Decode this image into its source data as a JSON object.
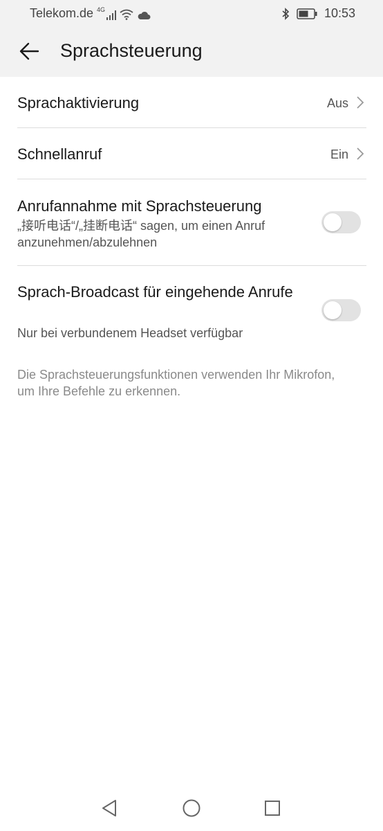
{
  "status_bar": {
    "carrier": "Telekom.de",
    "network": "4G",
    "time": "10:53"
  },
  "header": {
    "title": "Sprachsteuerung",
    "back_icon": "arrow-left-icon"
  },
  "settings": [
    {
      "title": "Sprachaktivierung",
      "value": "Aus",
      "type": "nav"
    },
    {
      "title": "Schnellanruf",
      "value": "Ein",
      "type": "nav"
    },
    {
      "title": "Anrufannahme mit Sprachsteuerung",
      "subtitle": "„接听电话“/„挂断电话“ sagen, um einen Anruf anzunehmen/abzulehnen",
      "type": "toggle",
      "enabled": false
    },
    {
      "title": "Sprach-Broadcast für eingehende Anrufe",
      "subtitle": "Nur bei verbundenem Headset verfügbar",
      "type": "toggle",
      "enabled": false
    }
  ],
  "footnote": "Die Sprachsteuerungsfunktionen verwenden Ihr Mikrofon, um Ihre Befehle zu erkennen.",
  "nav_bar": {
    "back_icon": "triangle-back-icon",
    "home_icon": "circle-home-icon",
    "recents_icon": "square-recents-icon"
  },
  "colors": {
    "header_bg": "#f2f2f2",
    "switch_off": "#e2e2e2",
    "divider": "#dcdcdc"
  }
}
